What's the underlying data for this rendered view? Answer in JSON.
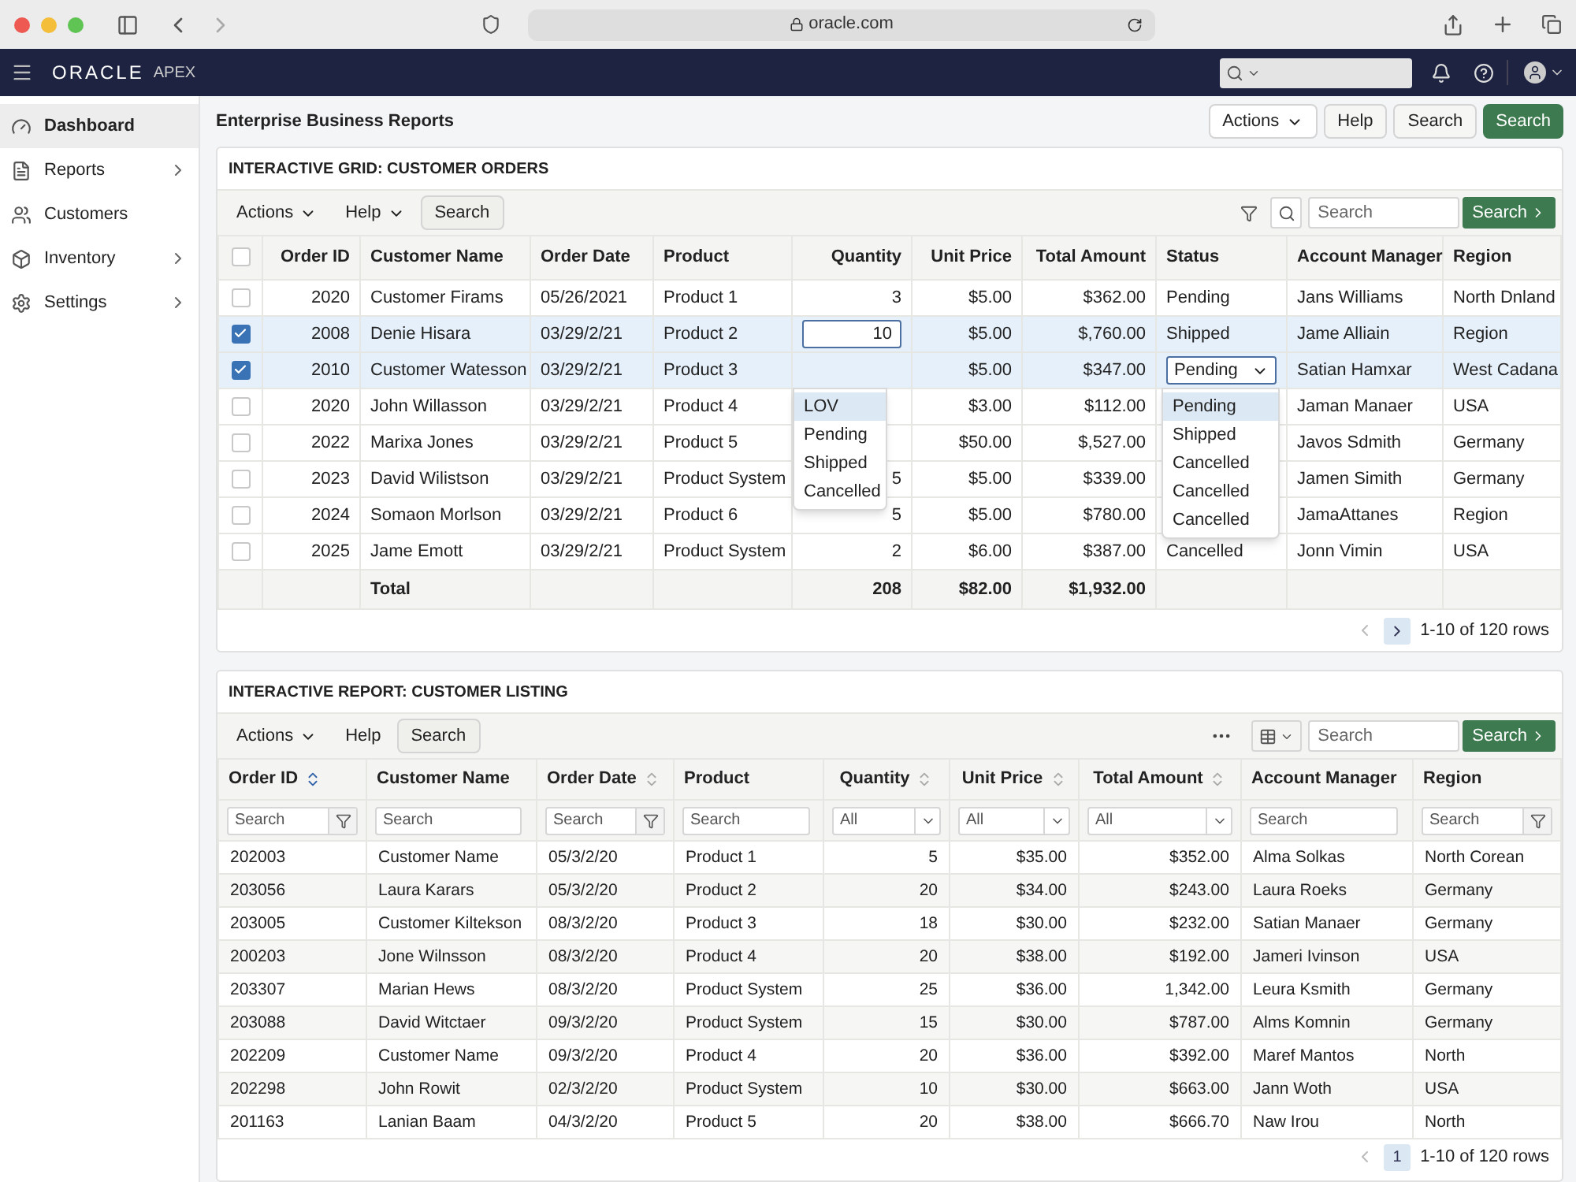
{
  "browser": {
    "url": "oracle.com"
  },
  "header": {
    "brand": "ORACLE",
    "product": "APEX"
  },
  "sidebar": {
    "items": [
      {
        "label": "Dashboard",
        "selected": true,
        "has_children": false
      },
      {
        "label": "Reports",
        "selected": false,
        "has_children": true
      },
      {
        "label": "Customers",
        "selected": false,
        "has_children": false
      },
      {
        "label": "Inventory",
        "selected": false,
        "has_children": true
      },
      {
        "label": "Settings",
        "selected": false,
        "has_children": true
      }
    ]
  },
  "page": {
    "title": "Enterprise Business Reports",
    "buttons": [
      {
        "label": "Actions",
        "kind": "menu"
      },
      {
        "label": "Help",
        "kind": "default"
      },
      {
        "label": "Search",
        "kind": "default"
      },
      {
        "label": "Search",
        "kind": "primary"
      }
    ]
  },
  "grid": {
    "title": "INTERACTIVE GRID: CUSTOMER ORDERS",
    "toolbar": {
      "items": [
        {
          "label": "Actions",
          "kind": "menu"
        },
        {
          "label": "Help",
          "kind": "menu"
        },
        {
          "label": "Search",
          "kind": "default"
        }
      ],
      "search_placeholder": "Search",
      "go_button": "Search"
    },
    "select_all": {
      "checked": false
    },
    "columns": [
      "Order ID",
      "Customer Name",
      "Order Date",
      "Product",
      "Quantity",
      "Unit Price",
      "Total Amount",
      "Status",
      "Account Manager",
      "Region"
    ],
    "rows": [
      {
        "checked": false,
        "cells": [
          "2020",
          "Customer Firams",
          "05/26/2021",
          "Product 1",
          "3",
          "$5.00",
          "$362.00",
          "Pending",
          "Jans Williams",
          "North Dnland"
        ]
      },
      {
        "checked": true,
        "cells": [
          "2008",
          "Denie Hisara",
          "03/29/2/21",
          "Product 2",
          {
            "kind": "input",
            "value": "10"
          },
          "$5.00",
          "$,760.00",
          "Shipped",
          "Jame Alliain",
          "Region"
        ]
      },
      {
        "checked": true,
        "cells": [
          "2010",
          "Customer Watesson",
          "03/29/2/21",
          "Product 3",
          {
            "kind": "lov",
            "options": [
              {
                "label": "LOV",
                "selected": true
              },
              {
                "label": "Pending",
                "selected": false
              },
              {
                "label": "Shipped",
                "selected": false
              },
              {
                "label": "Cancelled",
                "selected": false
              }
            ]
          },
          "$5.00",
          "$347.00",
          {
            "kind": "select",
            "value": "Pending",
            "options": [
              {
                "label": "Pending",
                "selected": true
              },
              {
                "label": "Shipped",
                "selected": false
              },
              {
                "label": "Cancelled",
                "selected": false
              },
              {
                "label": "Cancelled",
                "selected": false
              },
              {
                "label": "Cancelled",
                "selected": false
              }
            ]
          },
          "Satian Hamxar",
          "West Cadana"
        ]
      },
      {
        "checked": false,
        "cells": [
          "2020",
          "John Willasson",
          "03/29/2/21",
          "Product 4",
          null,
          "$3.00",
          "$112.00",
          null,
          "Jaman Manaer",
          "USA"
        ]
      },
      {
        "checked": false,
        "cells": [
          "2022",
          "Marixa Jones",
          "03/29/2/21",
          "Product 5",
          null,
          "$50.00",
          "$,527.00",
          null,
          "Javos Sdmith",
          "Germany"
        ]
      },
      {
        "checked": false,
        "cells": [
          "2023",
          "David Wilistson",
          "03/29/2/21",
          "Product System",
          "5",
          "$5.00",
          "$339.00",
          null,
          "Jamen Simith",
          "Germany"
        ]
      },
      {
        "checked": false,
        "cells": [
          "2024",
          "Somaon Morlson",
          "03/29/2/21",
          "Product 6",
          "5",
          "$5.00",
          "$780.00",
          null,
          "JamaAttanes",
          "Region"
        ]
      },
      {
        "checked": false,
        "cells": [
          "2025",
          "Jame Emott",
          "03/29/2/21",
          "Product System",
          "2",
          "$6.00",
          "$387.00",
          "Cancelled",
          "Jonn Vimin",
          "USA"
        ]
      }
    ],
    "totals": {
      "label": "Total",
      "quantity": "208",
      "unit_price": "$82.00",
      "total_amount": "$1,932.00"
    },
    "pagination": {
      "range": "1-10 of 120 rows"
    }
  },
  "report": {
    "title": "INTERACTIVE REPORT: CUSTOMER LISTING",
    "toolbar": {
      "items": [
        {
          "label": "Actions",
          "kind": "menu"
        },
        {
          "label": "Help",
          "kind": "plain"
        },
        {
          "label": "Search",
          "kind": "default"
        }
      ],
      "search_placeholder": "Search",
      "go_button": "Search"
    },
    "columns": [
      {
        "label": "Order ID",
        "sortable": true,
        "sorted": true,
        "filter": {
          "kind": "search_filter",
          "placeholder": "Search"
        }
      },
      {
        "label": "Customer Name",
        "sortable": false,
        "filter": {
          "kind": "search",
          "placeholder": "Search"
        }
      },
      {
        "label": "Order Date",
        "sortable": true,
        "sorted": false,
        "filter": {
          "kind": "search_filter",
          "placeholder": "Search"
        }
      },
      {
        "label": "Product",
        "sortable": false,
        "filter": {
          "kind": "search",
          "placeholder": "Search"
        }
      },
      {
        "label": "Quantity",
        "sortable": true,
        "sorted": false,
        "filter": {
          "kind": "select",
          "value": "All"
        }
      },
      {
        "label": "Unit Price",
        "sortable": true,
        "sorted": false,
        "filter": {
          "kind": "select",
          "value": "All"
        }
      },
      {
        "label": "Total Amount",
        "sortable": true,
        "sorted": false,
        "filter": {
          "kind": "select",
          "value": "All"
        }
      },
      {
        "label": "Account Manager",
        "sortable": false,
        "filter": {
          "kind": "search",
          "placeholder": "Search"
        }
      },
      {
        "label": "Region",
        "sortable": false,
        "filter": {
          "kind": "search_filter",
          "placeholder": "Search"
        }
      }
    ],
    "rows": [
      [
        "202003",
        "Customer Name",
        "05/3/2/20",
        "Product 1",
        "5",
        "$35.00",
        "$352.00",
        "Alma Solkas",
        "North Corean"
      ],
      [
        "203056",
        "Laura Karars",
        "05/3/2/20",
        "Product 2",
        "20",
        "$34.00",
        "$243.00",
        "Laura Roeks",
        "Germany"
      ],
      [
        "203005",
        "Customer Kiltekson",
        "08/3/2/20",
        "Product 3",
        "18",
        "$30.00",
        "$232.00",
        "Satian Manaer",
        "Germany"
      ],
      [
        "200203",
        "Jone Wilnsson",
        "08/3/2/20",
        "Product 4",
        "20",
        "$38.00",
        "$192.00",
        "Jameri Ivinson",
        "USA"
      ],
      [
        "203307",
        "Marian Hews",
        "08/3/2/20",
        "Product System",
        "25",
        "$36.00",
        "1,342.00",
        "Leura Ksmith",
        "Germany"
      ],
      [
        "203088",
        "David Witctaer",
        "09/3/2/20",
        "Product System",
        "15",
        "$30.00",
        "$787.00",
        "Alms Komnin",
        "Germany"
      ],
      [
        "202209",
        "Customer Name",
        "09/3/2/20",
        "Product 4",
        "20",
        "$36.00",
        "$392.00",
        "Maref Mantos",
        "North"
      ],
      [
        "202298",
        "John Rowit",
        "02/3/2/20",
        "Product System",
        "10",
        "$30.00",
        "$663.00",
        "Jann Woth",
        "USA"
      ],
      [
        "201163",
        "Lanian Baam",
        "04/3/2/20",
        "Product 5",
        "20",
        "$38.00",
        "$666.70",
        "Naw Irou",
        "North"
      ]
    ],
    "pagination": {
      "page": "1",
      "range": "1-10 of 120 rows"
    }
  }
}
